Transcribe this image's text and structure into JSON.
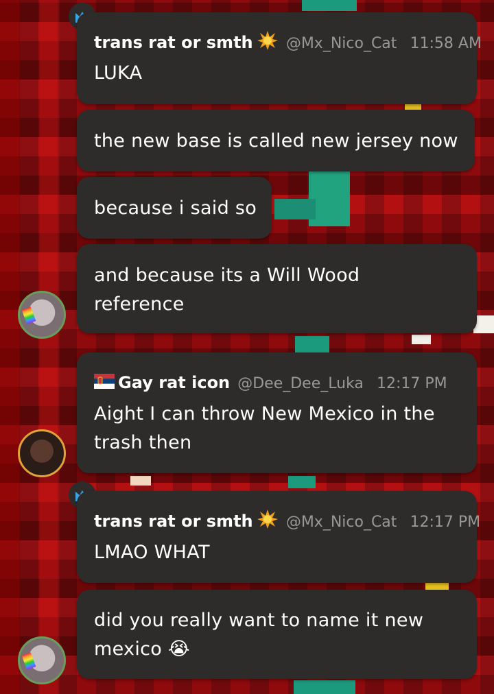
{
  "messages": [
    {
      "username": "trans rat or smth",
      "handle": "@Mx_Nico_Cat",
      "time": "11:58 AM",
      "text": [
        "LUKA"
      ],
      "badge": "crown-icon",
      "emoji": "collision-icon"
    },
    {
      "text": [
        "the new base is called new jersey now"
      ]
    },
    {
      "text": [
        "because i said so"
      ]
    },
    {
      "text": [
        "and because its a Will Wood",
        "reference"
      ]
    },
    {
      "username": "Gay rat icon",
      "handle": "@Dee_Dee_Luka",
      "time": "12:17 PM",
      "text": [
        "Aight I can throw New Mexico in the",
        "trash then"
      ],
      "flag": "serbia-flag-icon"
    },
    {
      "username": "trans rat or smth",
      "handle": "@Mx_Nico_Cat",
      "time": "12:17 PM",
      "text": [
        "LMAO WHAT"
      ],
      "badge": "crown-icon",
      "emoji": "collision-icon"
    },
    {
      "text": [
        "did you really want to name it new",
        "mexico 😭"
      ]
    }
  ],
  "colors": {
    "bubble": "#2e2c2b",
    "text": "#ffffff",
    "meta": "#9a9896",
    "crown": "#3aa6e8",
    "background": "#9e1114"
  }
}
